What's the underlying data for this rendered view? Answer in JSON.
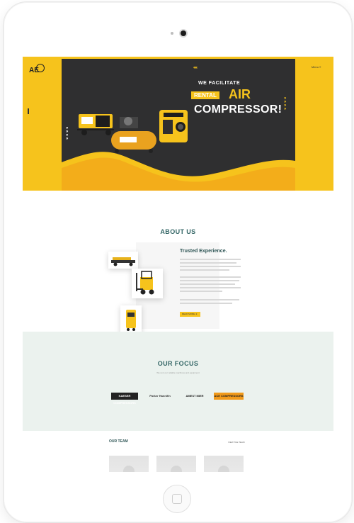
{
  "site": {
    "logo_text": "AE",
    "menu_label": "Menu  ≡"
  },
  "hero": {
    "line1": "WE FACILITATE",
    "highlight": "RENTAL",
    "accent_word": "AIR",
    "line3": "COMPRESSOR!",
    "chevrons_top": "‹‹‹‹‹",
    "chevrons_left": "»\n»\n»\n»",
    "chevrons_right": "»\n»\n»\n»"
  },
  "about": {
    "title": "ABOUT US",
    "heading": "Trusted Experience.",
    "button_label": "READ MORE  ➜"
  },
  "focus": {
    "title": "OUR FOCUS",
    "subtitle": "We rent our reliable machines and equipment",
    "brands": [
      "KAESER COMPRESSORS",
      "Parker Hannifin",
      "AMEST MIER",
      "ACE COMPRESSORS"
    ]
  },
  "team": {
    "title": "OUR TEAM",
    "link_label": "VIEW THE TEAM"
  },
  "colors": {
    "brand_yellow": "#f6c31c",
    "dark": "#2f2f30",
    "teal": "#356767",
    "mint_bg": "#ebf2ee"
  }
}
